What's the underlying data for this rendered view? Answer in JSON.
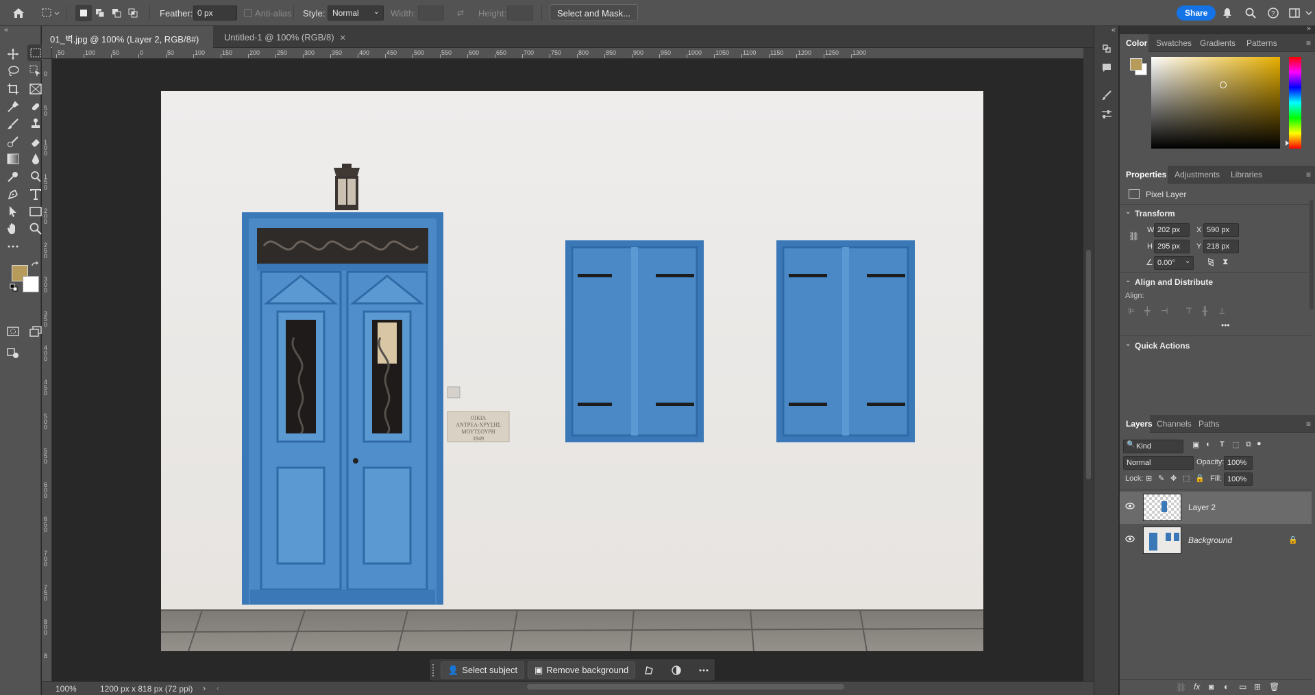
{
  "options_bar": {
    "feather_label": "Feather:",
    "feather_value": "0 px",
    "antialias_label": "Anti-alias",
    "style_label": "Style:",
    "style_value": "Normal",
    "width_label": "Width:",
    "height_label": "Height:",
    "select_mask_label": "Select and Mask...",
    "share_label": "Share"
  },
  "tabs": [
    {
      "label": "01_벽.jpg @ 100% (Layer 2, RGB/8#) *",
      "active": true
    },
    {
      "label": "Untitled-1 @ 100% (RGB/8)",
      "active": false
    }
  ],
  "ruler_h": [
    "50",
    "100",
    "50",
    "0",
    "50",
    "100",
    "150",
    "200",
    "250",
    "300",
    "350",
    "400",
    "450",
    "500",
    "550",
    "600",
    "650",
    "700",
    "750",
    "800",
    "850",
    "900",
    "950",
    "1000",
    "1050",
    "1100",
    "1150",
    "1200",
    "1250",
    "1300"
  ],
  "ruler_v": [
    "0",
    "5 0",
    "1 0 0",
    "1 5 0",
    "2 0 0",
    "2 5 0",
    "3 0 0",
    "3 5 0",
    "4 0 0",
    "4 5 0",
    "5 0 0",
    "5 5 0",
    "6 0 0",
    "6 5 0",
    "7 0 0",
    "7 5 0",
    "8 0 0",
    "8"
  ],
  "canvas": {
    "plaque_lines": [
      "ΟΙΚΙΑ",
      "ΑΝΤΡΕΑ-ΧΡΥΣΗΣ",
      "ΜΟΥΤΣΟΥΡΗ",
      "1949"
    ]
  },
  "context_bar": {
    "select_subject": "Select subject",
    "remove_background": "Remove background"
  },
  "status": {
    "zoom": "100%",
    "doc_info": "1200 px x 818 px (72 ppi)"
  },
  "color_panel": {
    "tabs": [
      "Color",
      "Swatches",
      "Gradients",
      "Patterns"
    ],
    "fg": "#b69b5a",
    "bg": "#ffffff"
  },
  "properties_panel": {
    "tabs": [
      "Properties",
      "Adjustments",
      "Libraries"
    ],
    "layer_type": "Pixel Layer",
    "transform_title": "Transform",
    "w_label": "W",
    "w_value": "202 px",
    "x_label": "X",
    "x_value": "590 px",
    "h_label": "H",
    "h_value": "295 px",
    "y_label": "Y",
    "y_value": "218 px",
    "angle_value": "0.00°",
    "align_title": "Align and Distribute",
    "align_label": "Align:",
    "quick_actions_title": "Quick Actions"
  },
  "layers_panel": {
    "tabs": [
      "Layers",
      "Channels",
      "Paths"
    ],
    "filter_value": "Kind",
    "blend_mode": "Normal",
    "opacity_label": "Opacity:",
    "opacity_value": "100%",
    "lock_label": "Lock:",
    "fill_label": "Fill:",
    "fill_value": "100%",
    "layers": [
      {
        "name": "Layer 2",
        "selected": true
      },
      {
        "name": "Background",
        "selected": false
      }
    ]
  },
  "accent": "#1473e6"
}
